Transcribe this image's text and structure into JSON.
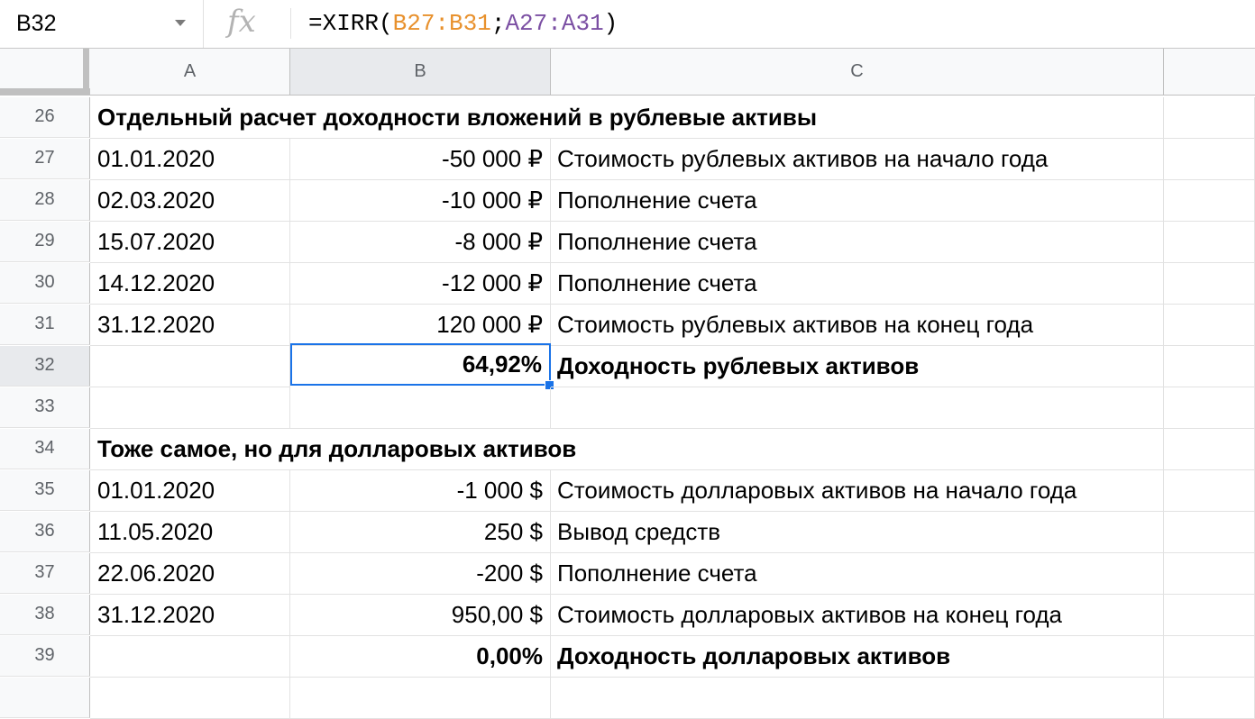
{
  "name_box": "B32",
  "formula_bar": {
    "fx_label": "fx",
    "prefix": "=XIRR(",
    "ref1": "B27:B31",
    "separator": ";",
    "ref2": "A27:A31",
    "suffix": ")"
  },
  "columns": [
    "A",
    "B",
    "C"
  ],
  "rows": [
    {
      "num": "26",
      "title": "Отдельный расчет доходности вложений в рублевые активы"
    },
    {
      "num": "27",
      "a": "01.01.2020",
      "b": "-50 000 ₽",
      "c": "Стоимость рублевых активов на начало года"
    },
    {
      "num": "28",
      "a": "02.03.2020",
      "b": "-10 000 ₽",
      "c": "Пополнение счета"
    },
    {
      "num": "29",
      "a": "15.07.2020",
      "b": "-8 000 ₽",
      "c": "Пополнение счета"
    },
    {
      "num": "30",
      "a": "14.12.2020",
      "b": "-12 000 ₽",
      "c": "Пополнение счета"
    },
    {
      "num": "31",
      "a": "31.12.2020",
      "b": "120 000 ₽",
      "c": "Стоимость рублевых активов на конец года"
    },
    {
      "num": "32",
      "a": "",
      "b": "64,92%",
      "c": "Доходность рублевых активов"
    },
    {
      "num": "33",
      "a": "",
      "b": "",
      "c": ""
    },
    {
      "num": "34",
      "title": "Тоже самое, но для долларовых активов"
    },
    {
      "num": "35",
      "a": "01.01.2020",
      "b": "-1 000 $",
      "c": "Стоимость долларовых активов на начало года"
    },
    {
      "num": "36",
      "a": "11.05.2020",
      "b": "250 $",
      "c": "Вывод средств"
    },
    {
      "num": "37",
      "a": "22.06.2020",
      "b": "-200 $",
      "c": "Пополнение счета"
    },
    {
      "num": "38",
      "a": "31.12.2020",
      "b": "950,00 $",
      "c": "Стоимость долларовых активов на конец года"
    },
    {
      "num": "39",
      "a": "",
      "b": "0,00%",
      "c": "Доходность долларовых активов"
    }
  ],
  "colors": {
    "selection": "#1a73e8",
    "ref1": "#e8912d",
    "ref2": "#7b4fa3"
  }
}
